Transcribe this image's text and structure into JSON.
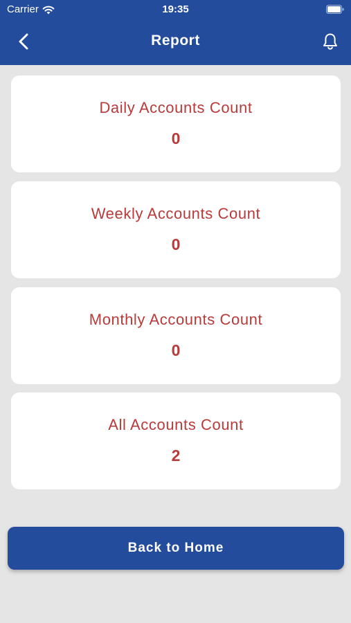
{
  "status_bar": {
    "carrier": "Carrier",
    "time": "19:35"
  },
  "nav": {
    "title": "Report",
    "back_icon": "chevron-left-icon",
    "action_icon": "bell-icon"
  },
  "cards": [
    {
      "label": "Daily Accounts Count",
      "value": "0"
    },
    {
      "label": "Weekly Accounts Count",
      "value": "0"
    },
    {
      "label": "Monthly Accounts Count",
      "value": "0"
    },
    {
      "label": "All Accounts Count",
      "value": "2"
    }
  ],
  "home_button": {
    "label": "Back to Home"
  },
  "colors": {
    "primary": "#244c9c",
    "accent_text": "#b83a3a",
    "background": "#e5e5e5",
    "card": "#ffffff"
  }
}
